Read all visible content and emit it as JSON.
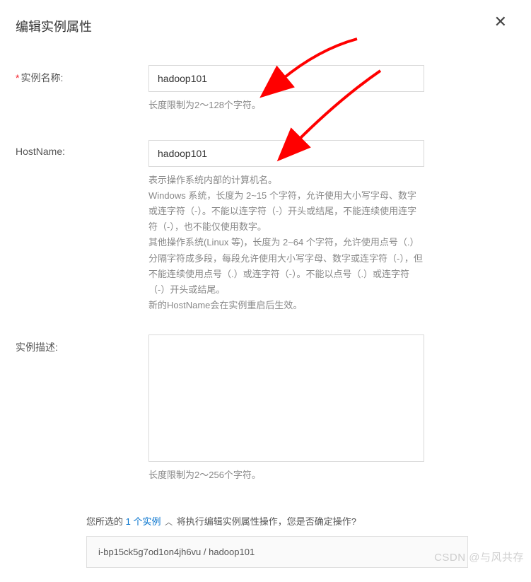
{
  "dialog": {
    "title": "编辑实例属性"
  },
  "form": {
    "instanceName": {
      "label": "实例名称:",
      "value": "hadoop101",
      "hint": "长度限制为2～128个字符。"
    },
    "hostName": {
      "label": "HostName:",
      "value": "hadoop101",
      "hint": "表示操作系统内部的计算机名。\nWindows 系统，长度为 2~15 个字符，允许使用大小写字母、数字或连字符（-）。不能以连字符（-）开头或结尾，不能连续使用连字符（-），也不能仅使用数字。\n其他操作系统(Linux 等)，长度为 2~64 个字符，允许使用点号（.）分隔字符成多段，每段允许使用大小写字母、数字或连字符（-），但不能连续使用点号（.）或连字符（-）。不能以点号（.）或连字符（-）开头或结尾。\n新的HostName会在实例重启后生效。"
    },
    "description": {
      "label": "实例描述:",
      "value": "",
      "hint": "长度限制为2～256个字符。"
    }
  },
  "confirm": {
    "prefix": "您所选的 ",
    "link": "1 个实例",
    "suffix": " 将执行编辑实例属性操作，您是否确定操作?"
  },
  "instanceBox": "i-bp15ck5g7od1on4jh6vu / hadoop101",
  "watermark": "CSDN @与风共存"
}
